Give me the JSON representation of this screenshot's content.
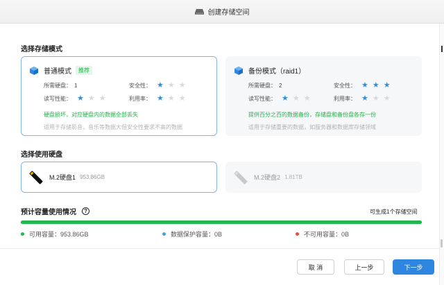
{
  "window": {
    "title": "创建存储空间"
  },
  "storage_mode": {
    "section_title": "选择存储模式",
    "modes": [
      {
        "title": "普通模式",
        "tag": "推荐",
        "disks_label": "所需硬盘：",
        "disks_value": "1",
        "safety_label": "安全性：",
        "safety_rating": 1,
        "rw_label": "读写性能：",
        "rw_rating": 1,
        "util_label": "利用率：",
        "util_rating": 1,
        "highlight": "硬盘损坏，对应硬盘内的数据全部丢失",
        "note": "适用于存储影音，音乐等数据大但安全性要求不高的数据",
        "selected": true
      },
      {
        "title": "备份模式（raid1）",
        "disks_label": "所需硬盘：",
        "disks_value": "2",
        "safety_label": "安全性：",
        "safety_rating": 3,
        "rw_label": "读写性能：",
        "rw_rating": 1,
        "util_label": "利用率：",
        "util_rating": 1,
        "highlight": "提供百分之百的数据备份，存储盘和备份盘各存一份",
        "note": "适用于存储重要的数据，如服务器和数据库存储领域",
        "selected": false
      }
    ]
  },
  "disk_select": {
    "section_title": "选择使用硬盘",
    "disks": [
      {
        "name": "M.2硬盘1",
        "size": "953.86GB",
        "selected": true
      },
      {
        "name": "M.2硬盘2",
        "size": "1.81TB",
        "selected": false
      }
    ]
  },
  "capacity": {
    "section_title": "预计容量使用情况",
    "help_icon": "?",
    "right_note": "可生成1个存储空间",
    "usage_fraction": 1.0,
    "legend": [
      {
        "label": "可用容量：",
        "value": "953.86GB",
        "color": "#22b84d"
      },
      {
        "label": "数据保护容量：",
        "value": "0B",
        "color": "#3ea6e6"
      },
      {
        "label": "不可用容量：",
        "value": "0B",
        "color": "#e84a3c"
      }
    ]
  },
  "footer": {
    "cancel_label": "取 消",
    "prev_label": "上一步",
    "next_label": "下一步"
  }
}
